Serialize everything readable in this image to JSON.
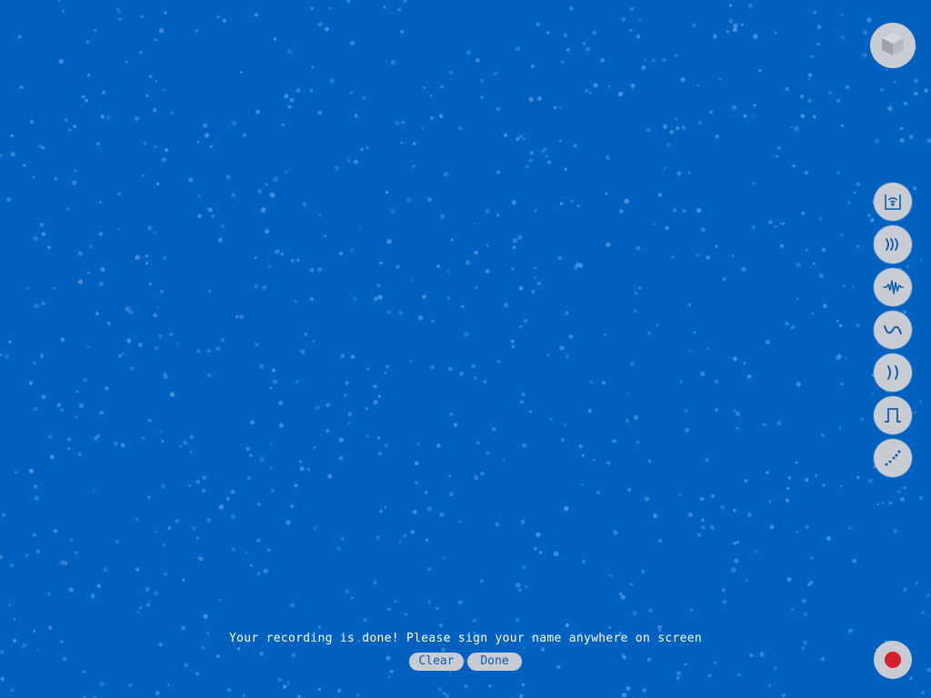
{
  "colors": {
    "background": "#0061c0",
    "button_bg": "#c9cdd3",
    "icon_color": "#0b5cab",
    "record_red": "#d51f2a",
    "particle": "#5a9ae0"
  },
  "top_button": {
    "icon": "cube-icon"
  },
  "tools": [
    {
      "name": "tool-wifi-box",
      "icon": "wifi-box-icon"
    },
    {
      "name": "tool-sound-waves",
      "icon": "sound-waves-icon"
    },
    {
      "name": "tool-noise-wave",
      "icon": "noise-wave-icon"
    },
    {
      "name": "tool-sine-wave",
      "icon": "sine-wave-icon"
    },
    {
      "name": "tool-parentheses",
      "icon": "parentheses-icon"
    },
    {
      "name": "tool-square-wave",
      "icon": "square-wave-icon"
    },
    {
      "name": "tool-dots",
      "icon": "dots-icon"
    }
  ],
  "record_button": {
    "icon": "record-icon"
  },
  "message": "Your recording is done! Please sign your name anywhere on screen",
  "actions": {
    "clear_label": "Clear",
    "done_label": "Done"
  }
}
